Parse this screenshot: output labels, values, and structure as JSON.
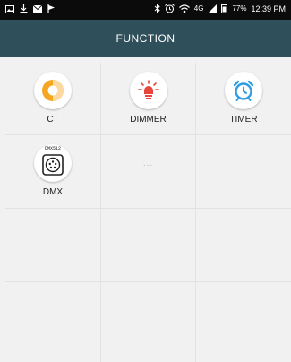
{
  "status_bar": {
    "network_label": "4G",
    "battery_percent": "77%",
    "time": "12:39 PM",
    "left_icons": [
      "gallery-icon",
      "download-icon",
      "mail-icon",
      "flag-icon"
    ],
    "right_icons": [
      "bluetooth-icon",
      "alarm-icon",
      "wifi-icon",
      "signal-icon",
      "battery-icon"
    ]
  },
  "header": {
    "title": "FUNCTION",
    "background_color": "#2f4f5a"
  },
  "functions": [
    {
      "label": "CT",
      "icon": "color-temperature-icon"
    },
    {
      "label": "DIMMER",
      "icon": "lightbulb-icon"
    },
    {
      "label": "TIMER",
      "icon": "alarm-clock-icon"
    },
    {
      "label": "DMX",
      "icon": "dmx-connector-icon",
      "caption": "DMX512"
    },
    {
      "label": "...",
      "icon": "more-icon"
    }
  ],
  "colors": {
    "ct": "#f5a623",
    "dimmer": "#e8453c",
    "timer": "#2f9ee0"
  }
}
